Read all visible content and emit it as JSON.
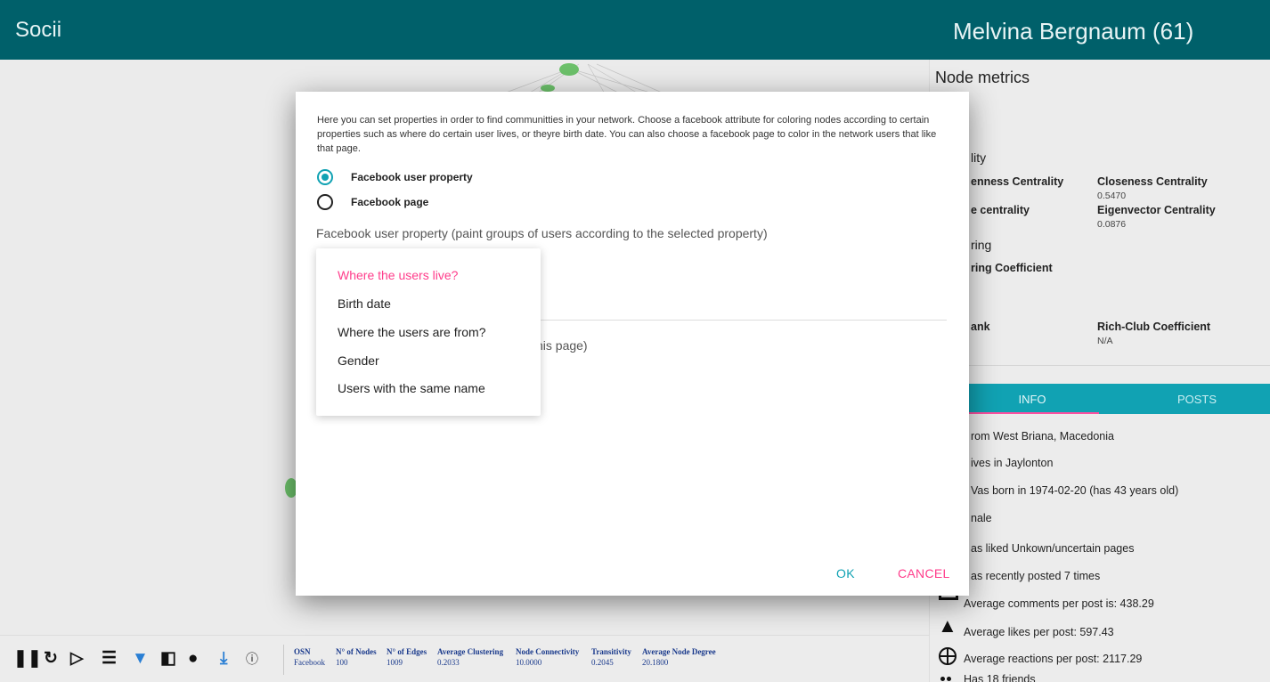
{
  "app": {
    "title": "Socii"
  },
  "panel": {
    "title": "Melvina Bergnaum (61)",
    "node_metrics_title": "Node metrics",
    "centrality_partial": "lity",
    "metrics": [
      {
        "label": "enness Centrality",
        "value": ""
      },
      {
        "label": "Closeness Centrality",
        "value": "0.5470"
      },
      {
        "label": "e centrality",
        "value": ""
      },
      {
        "label": "Eigenvector Centrality",
        "value": "0.0876"
      }
    ],
    "clustering_partial": "ring",
    "clustering_coeff_label": "ring Coefficient",
    "pagerank_partial": "ank",
    "rich_club_label": "Rich-Club Coefficient",
    "rich_club_value": "N/A",
    "tabs": [
      "INFO",
      "POSTS"
    ],
    "info": [
      {
        "icon": "home-icon",
        "text": "rom West Briana, Macedonia"
      },
      {
        "icon": "location-icon",
        "text": "ives in Jaylonton"
      },
      {
        "icon": "cake-icon",
        "text": "Vas born in 1974-02-20 (has 43 years old)"
      },
      {
        "icon": "gender-icon",
        "text": "nale"
      },
      {
        "icon": "like-page-icon",
        "text": "as liked Unkown/uncertain pages"
      },
      {
        "icon": "post-icon",
        "text": "as recently posted 7 times"
      },
      {
        "icon": "comment-icon",
        "text": "Average comments per post is: 438.29"
      },
      {
        "icon": "thumbs-up-icon",
        "text": "Average likes per post: 597.43"
      },
      {
        "icon": "reaction-icon",
        "text": "Average reactions per post: 2117.29"
      },
      {
        "icon": "friends-icon",
        "text": "Has 18 friends"
      }
    ]
  },
  "toolbar": {
    "stats": [
      {
        "header": "OSN",
        "value": "Facebook"
      },
      {
        "header": "N° of Nodes",
        "value": "100"
      },
      {
        "header": "N° of Edges",
        "value": "1009"
      },
      {
        "header": "Average Clustering",
        "value": "0.2033"
      },
      {
        "header": "Node Connectivity",
        "value": "10.0000"
      },
      {
        "header": "Transitivity",
        "value": "0.2045"
      },
      {
        "header": "Average Node Degree",
        "value": "20.1800"
      }
    ],
    "icons": [
      "pause-icon",
      "refresh-icon",
      "label-icon",
      "list-icon",
      "lightbulb-icon",
      "compare-icon",
      "community-icon",
      "download-icon",
      "info-icon"
    ]
  },
  "dialog": {
    "description": "Here you can set properties in order to find communitties in your network. Choose a facebook attribute for coloring nodes according to certain properties such as where do certain user lives, or theyre birth date. You can also choose a facebook page to color in the network users that like that page.",
    "option_user_property": "Facebook user property",
    "option_page": "Facebook page",
    "selected_option": "Facebook user property",
    "field_label": "Facebook user property (paint groups of users according to the selected property)",
    "partial_page_label": "his page)",
    "ok": "OK",
    "cancel": "CANCEL"
  },
  "dropdown": {
    "items": [
      "Where the users live?",
      "Birth date",
      "Where the users are from?",
      "Gender",
      "Users with the same name"
    ],
    "selected": "Where the users live?"
  },
  "colors": {
    "primary": "#00606a",
    "accent": "#11a2b3",
    "pink": "#ff3d8b",
    "node": "#6cc06a"
  }
}
